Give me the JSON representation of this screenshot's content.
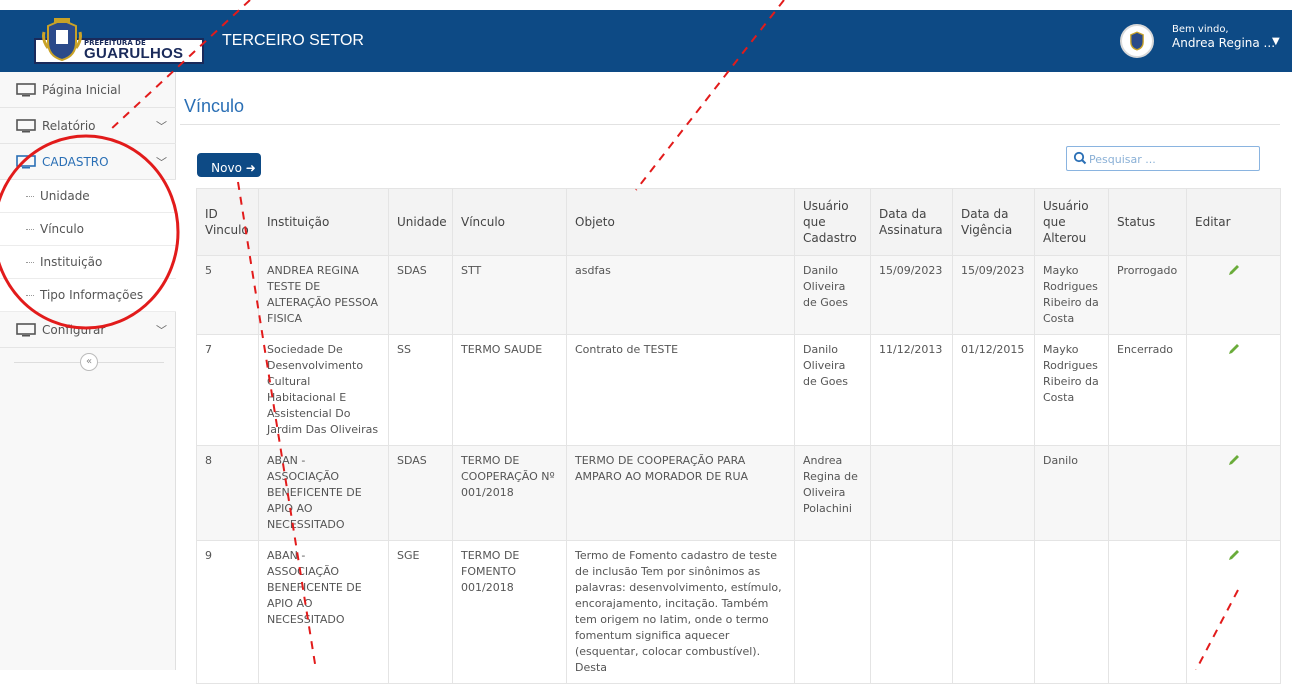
{
  "header": {
    "logo_small": "PREFEITURA DE",
    "logo_main": "GUARULHOS",
    "app_title": "TERCEIRO SETOR",
    "user_welcome": "Bem vindo,",
    "user_name": "Andrea Regina ...",
    "color": "#0d4a85"
  },
  "sidebar": {
    "items": [
      {
        "label": "Página Inicial",
        "icon": "monitor-icon"
      },
      {
        "label": "Relatório",
        "icon": "monitor-icon"
      },
      {
        "label": "CADASTRO",
        "icon": "monitor-icon"
      },
      {
        "label": "Configurar",
        "icon": "monitor-icon"
      }
    ],
    "subitems": [
      "Unidade",
      "Vínculo",
      "Instituição",
      "Tipo Informações"
    ],
    "collapse_glyph": "«"
  },
  "main": {
    "title": "Vínculo",
    "new_button": "Novo",
    "search_placeholder": "Pesquisar ...",
    "columns": [
      "ID Vinculo",
      "Instituição",
      "Unidade",
      "Vínculo",
      "Objeto",
      "Usuário que Cadastro",
      "Data da Assinatura",
      "Data da Vigência",
      "Usuário que Alterou",
      "Status",
      "Editar"
    ],
    "rows": [
      [
        "5",
        "ANDREA REGINA TESTE DE ALTERAÇÃO PESSOA FISICA",
        "SDAS",
        "STT",
        "asdfas",
        "Danilo Oliveira de Goes",
        "15/09/2023",
        "15/09/2023",
        "Mayko Rodrigues Ribeiro da Costa",
        "Prorrogado"
      ],
      [
        "7",
        "Sociedade De Desenvolvimento Cultural Habitacional E Assistencial Do Jardim Das Oliveiras",
        "SS",
        "TERMO SAUDE",
        "Contrato de TESTE",
        "Danilo Oliveira de Goes",
        "11/12/2013",
        "01/12/2015",
        "Mayko Rodrigues Ribeiro da Costa",
        "Encerrado"
      ],
      [
        "8",
        "ABAN - ASSOCIAÇÃO BENEFICENTE DE APIO AO NECESSITADO",
        "SDAS",
        "TERMO DE COOPERAÇÃO Nº 001/2018",
        "TERMO DE COOPERAÇÃO PARA AMPARO AO MORADOR DE RUA",
        "Andrea Regina de Oliveira Polachini",
        "",
        "",
        "Danilo",
        ""
      ],
      [
        "9",
        "ABAN - ASSOCIAÇÃO BENEFICENTE DE APIO AO NECESSITADO",
        "SGE",
        "TERMO DE FOMENTO 001/2018",
        "Termo de Fomento cadastro de teste de inclusão Tem por sinônimos as palavras: desenvolvimento, estímulo, encorajamento, incitação. Também tem origem no latim, onde o termo fomentum significa aquecer (esquentar, colocar combustível). Desta",
        "",
        "",
        "",
        "",
        ""
      ]
    ]
  }
}
